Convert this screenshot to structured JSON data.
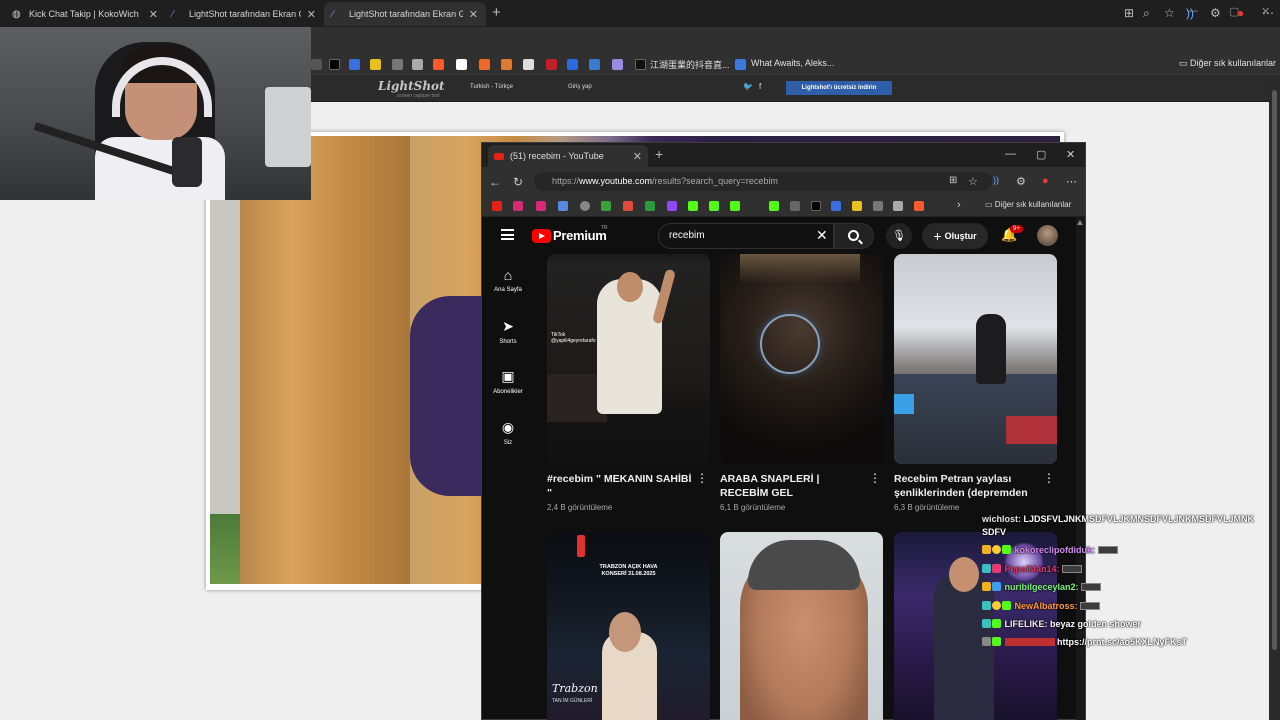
{
  "outer_browser": {
    "tabs": [
      {
        "title": "Kick Chat Takip | KokoWich",
        "active": false
      },
      {
        "title": "LightShot tarafından Ekran Görünt",
        "active": false
      },
      {
        "title": "LightShot tarafından Ekran Görünt",
        "active": true
      }
    ],
    "bookmarks": {
      "chinese_label": "江湖蛋業的抖音直...",
      "what_awaits": "What Awaits, Aleks...",
      "other_favorites": "Diğer sık kullanılanlar"
    }
  },
  "lightshot": {
    "logo": "LightShot",
    "logo_sub": "screen capture tool",
    "language": "Turkish - Türkçe",
    "login": "Giriş yap",
    "download": "Lightshot'ı ücretsiz indirin"
  },
  "youtube_window": {
    "tab_title": "(51) recebim - YouTube",
    "url_prefix": "https://",
    "url_domain": "www.youtube.com",
    "url_path": "/results?search_query=recebim",
    "other_favorites": "Diğer sık kullanılanlar",
    "logo_text": "Premium",
    "logo_region": "TR",
    "search_value": "recebim",
    "create_label": "Oluştur",
    "notification_count": "9+",
    "sidebar": [
      {
        "label": "Ana Sayfa",
        "icon": "home-icon"
      },
      {
        "label": "Shorts",
        "icon": "shorts-icon"
      },
      {
        "label": "Abonelikler",
        "icon": "subscriptions-icon"
      },
      {
        "label": "Siz",
        "icon": "account-icon"
      }
    ],
    "videos": [
      {
        "title": "#recebim \" MEKANIN SAHİBİ \"",
        "views": "2,4 B görüntüleme",
        "overlay": "TikTok\n@yapili4geyretarafo"
      },
      {
        "title": "ARABA SNAPLERİ | RECEBİM GEL",
        "views": "6,1 B görüntüleme"
      },
      {
        "title": "Recebim Petran yaylası şenliklerinden (depremden ...",
        "views": "6,3 B görüntüleme"
      },
      {
        "title": "",
        "views": "",
        "overlay": "TRABZON AÇIK HAVA\nKONSERİ 31.08.2025",
        "script": "Trabzon",
        "sub": "TAN İM GÜNLERİ"
      },
      {
        "title": "",
        "views": ""
      },
      {
        "title": "",
        "views": ""
      }
    ]
  },
  "chat": [
    {
      "user": "wichlost:",
      "message": "LJDSFVLJNKMSDFVLJKMNSDFVLJNKMSDFVLJMNK",
      "message2": "SDFV",
      "user_color": "#e6e6e6"
    },
    {
      "user": "kokoreclipofdiduk:",
      "message": "",
      "user_color": "#d58cf5",
      "emote": true
    },
    {
      "user": "PepsiMan14:",
      "message": "",
      "user_color": "#e6396e",
      "emote": true
    },
    {
      "user": "nuribilgeceylan2:",
      "message": "",
      "user_color": "#7cf57c",
      "emote": true
    },
    {
      "user": "NewAlbatross:",
      "message": "",
      "user_color": "#ff9c3a",
      "emote": true
    },
    {
      "user": "LIFELIKE:",
      "message": "beyaz golden shower",
      "user_color": "#f0f0f0"
    },
    {
      "user": "",
      "message": "https://prnt.sc/ao5KXLNyFKsT",
      "user_color": "#e04040"
    }
  ]
}
